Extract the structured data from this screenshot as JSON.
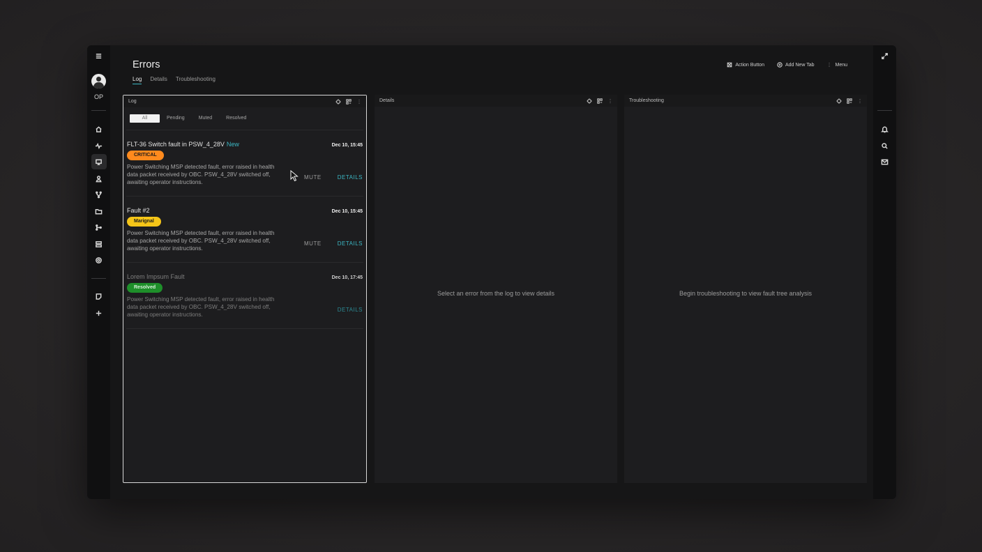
{
  "app": {
    "title": "Errors",
    "user_initials": "OP"
  },
  "tabs": [
    {
      "label": "Log",
      "active": true
    },
    {
      "label": "Details",
      "active": false
    },
    {
      "label": "Troubleshooting",
      "active": false
    }
  ],
  "top_actions": {
    "action_button": "Action Button",
    "add_new_tab": "Add New Tab",
    "menu": "Menu"
  },
  "panels": {
    "log": {
      "title": "Log"
    },
    "details": {
      "title": "Details",
      "empty_message": "Select an error from the log to view details"
    },
    "troubleshooting": {
      "title": "Troubleshooting",
      "empty_message": "Begin troubleshooting to view fault tree analysis"
    }
  },
  "filters": [
    {
      "label": "All",
      "active": true
    },
    {
      "label": "Pending",
      "active": false
    },
    {
      "label": "Muted",
      "active": false
    },
    {
      "label": "Resolved",
      "active": false
    }
  ],
  "entries": [
    {
      "title": "FLT-36 Switch fault in PSW_4_28V",
      "new_label": "New",
      "date": "Dec 10, 15:45",
      "badge": "CRITICAL",
      "description": "Power Switching MSP detected fault, error raised in health data packet received by OBC. PSW_4_28V switched off, awaiting operator instructions.",
      "mute_label": "MUTE",
      "details_label": "DETAILS"
    },
    {
      "title": "Fault #2",
      "date": "Dec 10, 15:45",
      "badge": "Marignal",
      "description": "Power Switching MSP detected fault, error raised in health data packet received by OBC. PSW_4_28V switched off, awaiting operator instructions.",
      "mute_label": "MUTE",
      "details_label": "DETAILS"
    },
    {
      "title": "Lorem Impsum Fault",
      "date": "Dec 10, 17:45",
      "badge": "Resolved",
      "description": "Power Switching MSP detected fault, error raised in health data packet received by OBC. PSW_4_28V switched off, awaiting operator instructions.",
      "details_label": "DETAILS"
    }
  ],
  "colors": {
    "accent": "#3bb7c4",
    "critical": "#ff8a1d",
    "marginal": "#f5c518",
    "resolved": "#1e8f2a"
  },
  "icons": {
    "left_nav": [
      "menu-icon",
      "home-icon",
      "pulse-icon",
      "monitor-icon",
      "user-badge-icon",
      "fork-icon",
      "folder-icon",
      "branch-icon",
      "server-icon",
      "settings-icon",
      "note-icon",
      "plus-icon"
    ],
    "right_nav": [
      "expand-icon",
      "bell-icon",
      "search-icon",
      "mail-icon"
    ]
  }
}
